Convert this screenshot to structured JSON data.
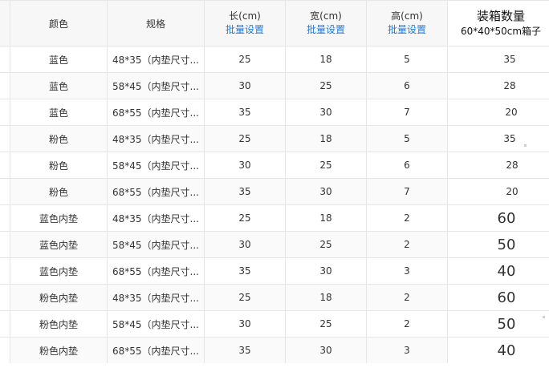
{
  "headers": {
    "color": "颜色",
    "spec": "规格",
    "length": "长(cm)",
    "width": "宽(cm)",
    "height": "高(cm)",
    "batch": "批量设置",
    "pack_title": "装箱数量",
    "pack_sub": "60*40*50cm箱子"
  },
  "rows": [
    {
      "color": "蓝色",
      "spec": "48*35（内垫尺寸...",
      "length": "25",
      "width": "18",
      "height": "5",
      "pack": "35"
    },
    {
      "color": "蓝色",
      "spec": "58*45（内垫尺寸...",
      "length": "30",
      "width": "25",
      "height": "6",
      "pack": "28"
    },
    {
      "color": "蓝色",
      "spec": "68*55（内垫尺寸...",
      "length": "35",
      "width": "30",
      "height": "7",
      "pack": "20"
    },
    {
      "color": "粉色",
      "spec": "48*35（内垫尺寸...",
      "length": "25",
      "width": "18",
      "height": "5",
      "pack": "35"
    },
    {
      "color": "粉色",
      "spec": "58*45（内垫尺寸...",
      "length": "30",
      "width": "25",
      "height": "6",
      "pack": "28"
    },
    {
      "color": "粉色",
      "spec": "68*55（内垫尺寸...",
      "length": "35",
      "width": "30",
      "height": "7",
      "pack": "20"
    },
    {
      "color": "蓝色内垫",
      "spec": "48*35（内垫尺寸...",
      "length": "25",
      "width": "18",
      "height": "2",
      "pack": "60"
    },
    {
      "color": "蓝色内垫",
      "spec": "58*45（内垫尺寸...",
      "length": "30",
      "width": "25",
      "height": "2",
      "pack": "50"
    },
    {
      "color": "蓝色内垫",
      "spec": "68*55（内垫尺寸...",
      "length": "35",
      "width": "30",
      "height": "3",
      "pack": "40"
    },
    {
      "color": "粉色内垫",
      "spec": "48*35（内垫尺寸...",
      "length": "25",
      "width": "18",
      "height": "2",
      "pack": "60"
    },
    {
      "color": "粉色内垫",
      "spec": "58*45（内垫尺寸...",
      "length": "30",
      "width": "25",
      "height": "2",
      "pack": "50"
    },
    {
      "color": "粉色内垫",
      "spec": "68*55（内垫尺寸...",
      "length": "35",
      "width": "30",
      "height": "3",
      "pack": "40"
    }
  ]
}
